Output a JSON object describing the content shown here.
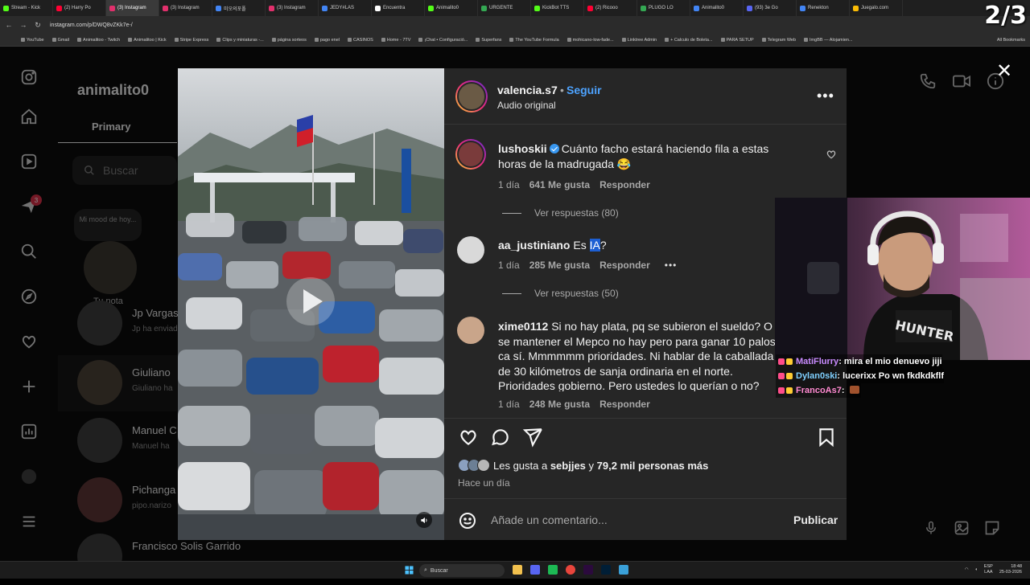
{
  "browser": {
    "tabs": [
      {
        "label": "Stream - Kick",
        "color": "#53fc18"
      },
      {
        "label": "(2) Harry Po",
        "color": "#ff0033"
      },
      {
        "label": "(3) Instagram",
        "color": "#e1306c",
        "active": true
      },
      {
        "label": "(3) Instagram",
        "color": "#e1306c"
      },
      {
        "label": "미오의포폴",
        "color": "#4285f4"
      },
      {
        "label": "(3) Instagram",
        "color": "#e1306c"
      },
      {
        "label": "JEDY#LAS",
        "color": "#4285f4"
      },
      {
        "label": "Encuentra",
        "color": "#ffffff"
      },
      {
        "label": "Animalito0",
        "color": "#53fc18"
      },
      {
        "label": "URGENTE",
        "color": "#34a853"
      },
      {
        "label": "KickBot TTS",
        "color": "#53fc18"
      },
      {
        "label": "(2) Ricooo",
        "color": "#ff0033"
      },
      {
        "label": "PLUGO LO",
        "color": "#34a853"
      },
      {
        "label": "Animalito0",
        "color": "#4285f4"
      },
      {
        "label": "(93) 3e Go",
        "color": "#5865f2"
      },
      {
        "label": "Renekton",
        "color": "#4285f4"
      },
      {
        "label": "Juegalo.com",
        "color": "#fbbc05"
      }
    ],
    "tab_count": "2/3",
    "url": "instagram.com/p/DWQ8vZKk7e-/",
    "bookmarks": [
      "YouTube",
      "Gmail",
      "Animalitoo - Twitch",
      "Animalitoo | Kick",
      "Stripe Express",
      "Clips y miniaturas -...",
      "página sorteos",
      "pago enel",
      "CASINOS",
      "Home - 7TV",
      "¡Chat • Configuració...",
      "Superfans",
      "The YouTube Formula",
      "mohicano-low-fade...",
      "Linktree Admin",
      "+ Calculo de Boleta...",
      "PARA SETUP",
      "Telegram Web",
      "ImgBB — Alojamien..."
    ],
    "all_bookmarks": "All Bookmarks"
  },
  "instagram": {
    "username": "animalito0",
    "primary_tab": "Primary",
    "search_placeholder": "Buscar",
    "note_bubble": "Mi mood de hoy...",
    "note_label": "Tu nota",
    "notification_badge": "3",
    "conversations": [
      {
        "name": "Jp Vargas",
        "preview": "Jp ha enviado"
      },
      {
        "name": "Giuliano",
        "preview": "Giuliano ha"
      },
      {
        "name": "Manuel C",
        "preview": "Manuel ha"
      },
      {
        "name": "Pichanga",
        "preview": "pipo.narizo"
      },
      {
        "name": "Francisco Solis Garrido",
        "preview": ""
      }
    ]
  },
  "post": {
    "author": "valencia.s7",
    "follow_label": "Seguir",
    "audio": "Audio original",
    "comments": [
      {
        "user": "lushoskii",
        "verified": true,
        "text": "Cuánto facho estará haciendo fila a estas horas de la madrugada 😂",
        "time": "1 día",
        "likes": "641 Me gusta",
        "reply": "Responder",
        "view_replies": "Ver respuestas (80)"
      },
      {
        "user": "aa_justiniano",
        "text_before": "Es ",
        "text_highlight": "IA",
        "text_after": "?",
        "time": "1 día",
        "likes": "285 Me gusta",
        "reply": "Responder",
        "view_replies": "Ver respuestas (50)"
      },
      {
        "user": "xime0112",
        "text": "Si no hay plata, pq se subieron el sueldo? O se mantener el Mepco no hay pero para ganar 10 palos ca sí. Mmmmmm prioridades. Ni hablar de la caballada de 30 kilómetros de sanja ordinaria en el norte. Prioridades gobierno. Pero ustedes lo querían o no?",
        "time": "1 día",
        "likes": "248 Me gusta",
        "reply": "Responder"
      }
    ],
    "likes_prefix": "Les gusta a ",
    "likes_user": "sebjjes",
    "likes_middle": " y ",
    "likes_count": "79,2 mil personas más",
    "time_ago": "Hace un día",
    "comment_placeholder": "Añade un comentario...",
    "publish": "Publicar"
  },
  "stream_chat": [
    {
      "user": "MatiFlurry",
      "color": "#c98bff",
      "message": " mira el mio denuevo jiji"
    },
    {
      "user": "Dylan0ski",
      "color": "#7fd0ff",
      "message": " lucerixx Po wn fkdkdkflf"
    },
    {
      "user": "FrancoAs7",
      "color": "#ff8ad1",
      "message": " "
    }
  ],
  "taskbar": {
    "search": "Buscar",
    "lang_top": "ESP",
    "lang_bottom": "LAA",
    "time": "18:48",
    "date": "25-03-2026"
  }
}
